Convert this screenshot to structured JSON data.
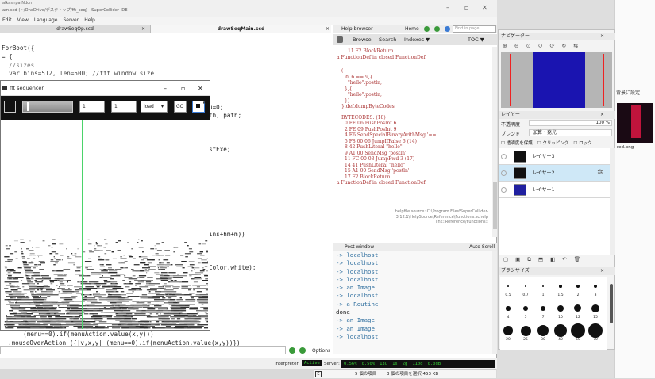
{
  "ide": {
    "title_line1": "alkasirpa Ndon",
    "title_line2": "am.scd (~/OneDrive/デスクトップ/fft_seq) - SuperCollider IDE",
    "menu": [
      "Edit",
      "View",
      "Language",
      "Server",
      "Help"
    ],
    "tabs": {
      "left": "drawSeqOp.scd",
      "right": "drawSeqMain.scd"
    },
    "code_lines": [
      "ForBoot({",
      "= {",
      "  //sizes",
      "  var bins=512, len=500; //fft window size",
      "u=0;",
      "th, path;",
      "stExe;",
      "ins+hm+m))",
      "Color.white);",
      "  (menu==0).if(menuAction.value(x,y)))",
      ".mouseOverAction_({|v,x,y| (menu==0).if(menuAction.value(x,y))})"
    ],
    "options_label": "Options",
    "interpreter_label": "Interpreter:",
    "interpreter_state": "Active",
    "server_label": "Server:",
    "server_stats": [
      "0.56%",
      "0.50%",
      "13u",
      "1s",
      "2g",
      "110d",
      "0.0dB"
    ]
  },
  "help": {
    "title": "Help browser",
    "home": "Home",
    "find_placeholder": "Find in page",
    "tabs": [
      "Browse",
      "Search",
      "Indexes ▼"
    ],
    "toc": "TOC ▼",
    "lines_top": [
      "11  F2    BlockReturn",
      "a FunctionDef in closed FunctionDef"
    ],
    "code_block": [
      "(",
      "  if( 6 == 9,{",
      "    \"hello\".postln;",
      "  },{",
      "    \"hello\".postln;",
      "  })",
      "}.def.dumpByteCodes"
    ],
    "bytecodes_title": "BYTECODES: (18)",
    "bytecodes": [
      "0   FE 06    PushPosInt 6",
      "2   FE 09    PushPosInt 9",
      "4   E6       SendSpecialBinaryArithMsg '=='",
      "5   F8 00 06 JumpIfFalse 6  (14)",
      "8   42       PushLiteral \"hello\"",
      "9   A1 00    SendMsg 'postln'",
      "11  FC 00 03 JumpFwd 3  (17)",
      "14  41       PushLiteral \"hello\"",
      "15  A1 00    SendMsg 'postln'",
      "17  F2       BlockReturn",
      "a FunctionDef in closed FunctionDef"
    ],
    "source_note": [
      "helpfile source: C:\\Program Files\\SuperCollider-",
      "3.12.1\\HelpSource\\Reference\\Functions.schelp",
      "link::Reference/Functions::"
    ]
  },
  "post": {
    "title": "Post window",
    "autoscroll": "Auto Scroll",
    "lines": [
      "-> localhost",
      "-> localhost",
      "-> localhost",
      "-> localhost",
      "-> an Image",
      "-> localhost",
      "-> a Routine",
      "done",
      "-> an Image",
      "-> an Image",
      "-> localhost"
    ]
  },
  "fft": {
    "title": "fft sequencer",
    "field1": "1",
    "field2": "1",
    "dropdown": "load",
    "go_button": "GO"
  },
  "ps": {
    "navigator": "ナビゲーター",
    "layer_title": "レイヤー",
    "opacity_label": "不透明度",
    "opacity_value": "100 %",
    "blend_label": "ブレンド",
    "blend_value": "加算・発光",
    "lock_opts": [
      "透明度を保護",
      "クリッピング",
      "ロック"
    ],
    "layers": [
      {
        "name": "レイヤー3",
        "color": "#111111"
      },
      {
        "name": "レイヤー2",
        "color": "#111111"
      },
      {
        "name": "レイヤー1",
        "color": "#2020a0"
      }
    ],
    "brush_title": "ブラシサイズ",
    "brush_sizes": [
      "0.5",
      "0.7",
      "1",
      "1.5",
      "2",
      "3",
      "4",
      "5",
      "7",
      "10",
      "12",
      "15",
      "20",
      "25",
      "30",
      "40",
      "50",
      "70"
    ]
  },
  "right_fragments": {
    "settings": "背景に設定",
    "file": "red.png"
  },
  "taskbar": {
    "items": "5 個の項目",
    "selection": "3 個の項目を選択  453 KB"
  }
}
